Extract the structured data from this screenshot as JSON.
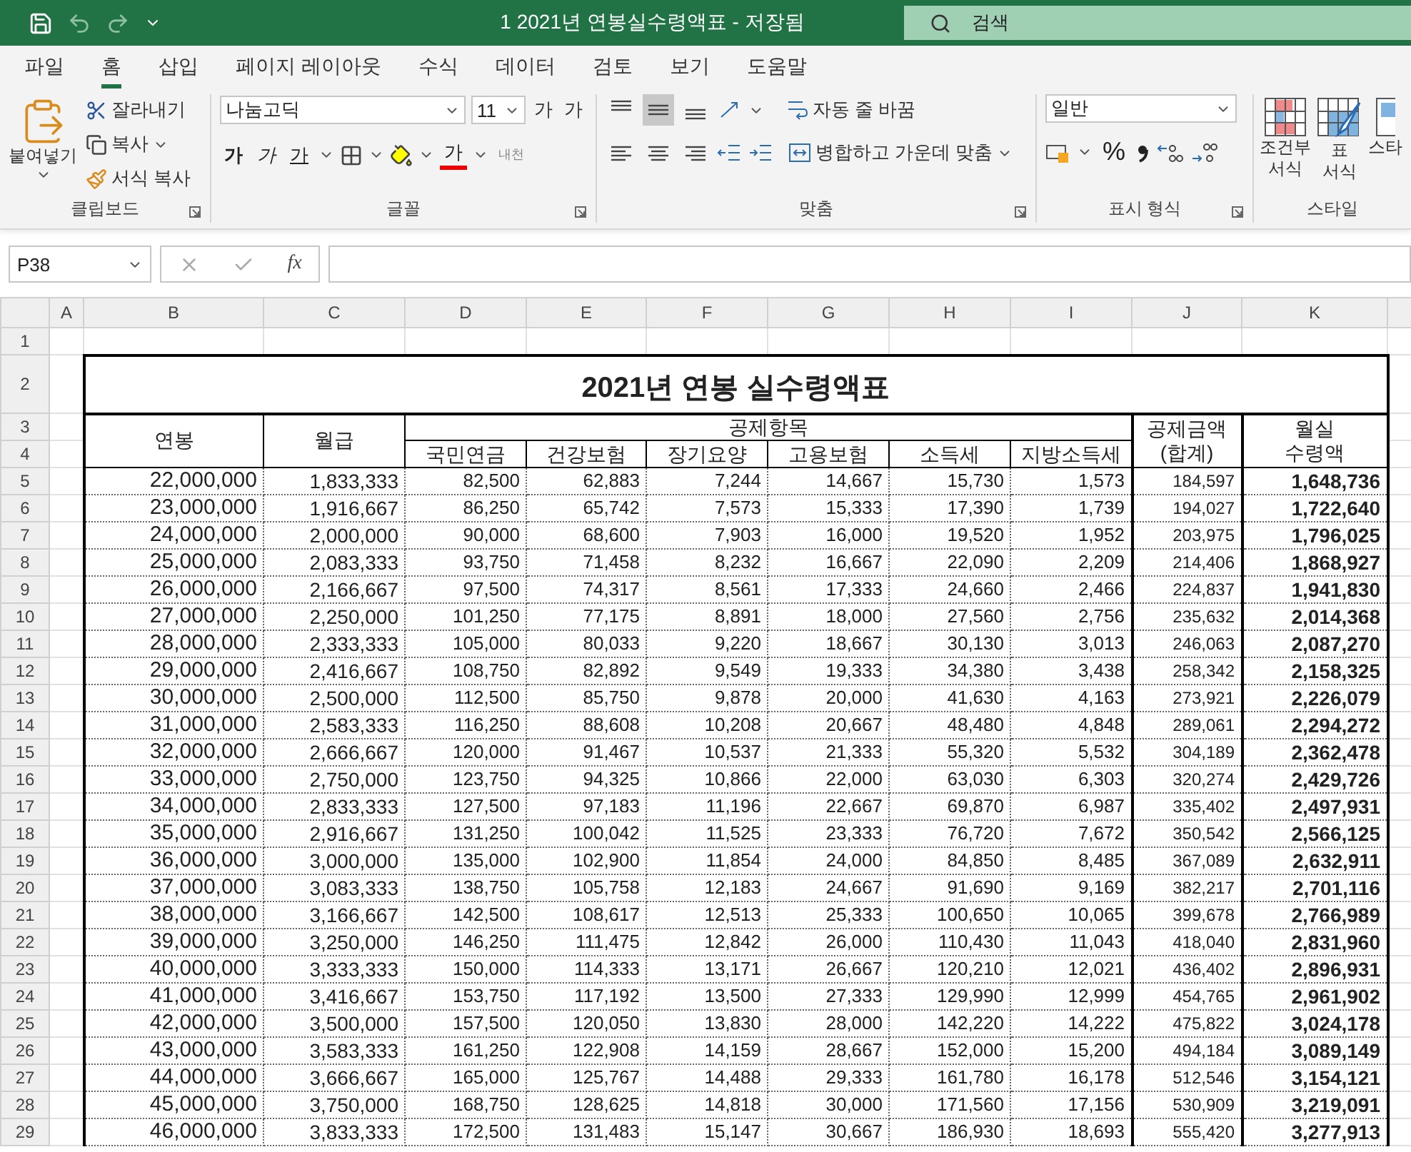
{
  "title_bar": {
    "title": "1 2021년 연봉실수령액표  -  저장됨",
    "search_placeholder": "검색"
  },
  "menu_tabs": [
    {
      "label": "파일",
      "selected": false
    },
    {
      "label": "홈",
      "selected": true
    },
    {
      "label": "삽입",
      "selected": false
    },
    {
      "label": "페이지 레이아웃",
      "selected": false
    },
    {
      "label": "수식",
      "selected": false
    },
    {
      "label": "데이터",
      "selected": false
    },
    {
      "label": "검토",
      "selected": false
    },
    {
      "label": "보기",
      "selected": false
    },
    {
      "label": "도움말",
      "selected": false
    }
  ],
  "ribbon": {
    "clipboard": {
      "label": "클립보드",
      "paste": "붙여넣기",
      "cut": "잘라내기",
      "copy": "복사",
      "format_painter": "서식 복사"
    },
    "font": {
      "label": "글꼴",
      "font_name": "나눔고딕",
      "font_size": "11",
      "grow": "가",
      "shrink": "가",
      "bold": "가",
      "italic": "가",
      "underline": "가",
      "font_color": "가",
      "phonetic": "내천"
    },
    "alignment": {
      "label": "맞춤",
      "vertical": [
        {
          "kind": "top",
          "selected": false
        },
        {
          "kind": "middle",
          "selected": true
        },
        {
          "kind": "bottom",
          "selected": false
        }
      ],
      "horizontal": [
        {
          "kind": "left",
          "selected": false
        },
        {
          "kind": "center",
          "selected": false
        },
        {
          "kind": "right",
          "selected": false
        }
      ],
      "wrap_text": "자동 줄 바꿈",
      "merge_center": "병합하고 가운데 맞춤"
    },
    "number": {
      "label": "표시 형식",
      "format": "일반",
      "percent": "%"
    },
    "styles": {
      "label": "스타일",
      "items": [
        {
          "kind": "conditional",
          "lines": [
            "조건부",
            "서식"
          ]
        },
        {
          "kind": "table",
          "lines": [
            "표",
            "서식"
          ]
        },
        {
          "kind": "cell",
          "lines": [
            "스타"
          ]
        }
      ]
    }
  },
  "formula_bar": {
    "name_box": "P38",
    "function_label": "fx"
  },
  "column_letters": [
    "A",
    "B",
    "C",
    "D",
    "E",
    "F",
    "G",
    "H",
    "I",
    "J",
    "K"
  ],
  "row_numbers": [
    "1",
    "2",
    "3",
    "4",
    "5",
    "6",
    "7",
    "8",
    "9",
    "10",
    "11",
    "12",
    "13",
    "14",
    "15",
    "16",
    "17",
    "18",
    "19",
    "20",
    "21",
    "22",
    "23",
    "24",
    "25",
    "26",
    "27",
    "28",
    "29"
  ],
  "sheet": {
    "title": "2021년 연봉 실수령액표",
    "headers": {
      "annual": "연봉",
      "monthly": "월급",
      "deductions": "공제항목",
      "deduction_items": [
        "국민연금",
        "건강보험",
        "장기요양",
        "고용보험",
        "소득세",
        "지방소득세"
      ],
      "total": "공제금액\n(합계)",
      "net": "월실\n수령액"
    },
    "rows": [
      [
        "22,000,000",
        "1,833,333",
        "82,500",
        "62,883",
        "7,244",
        "14,667",
        "15,730",
        "1,573",
        "184,597",
        "1,648,736"
      ],
      [
        "23,000,000",
        "1,916,667",
        "86,250",
        "65,742",
        "7,573",
        "15,333",
        "17,390",
        "1,739",
        "194,027",
        "1,722,640"
      ],
      [
        "24,000,000",
        "2,000,000",
        "90,000",
        "68,600",
        "7,903",
        "16,000",
        "19,520",
        "1,952",
        "203,975",
        "1,796,025"
      ],
      [
        "25,000,000",
        "2,083,333",
        "93,750",
        "71,458",
        "8,232",
        "16,667",
        "22,090",
        "2,209",
        "214,406",
        "1,868,927"
      ],
      [
        "26,000,000",
        "2,166,667",
        "97,500",
        "74,317",
        "8,561",
        "17,333",
        "24,660",
        "2,466",
        "224,837",
        "1,941,830"
      ],
      [
        "27,000,000",
        "2,250,000",
        "101,250",
        "77,175",
        "8,891",
        "18,000",
        "27,560",
        "2,756",
        "235,632",
        "2,014,368"
      ],
      [
        "28,000,000",
        "2,333,333",
        "105,000",
        "80,033",
        "9,220",
        "18,667",
        "30,130",
        "3,013",
        "246,063",
        "2,087,270"
      ],
      [
        "29,000,000",
        "2,416,667",
        "108,750",
        "82,892",
        "9,549",
        "19,333",
        "34,380",
        "3,438",
        "258,342",
        "2,158,325"
      ],
      [
        "30,000,000",
        "2,500,000",
        "112,500",
        "85,750",
        "9,878",
        "20,000",
        "41,630",
        "4,163",
        "273,921",
        "2,226,079"
      ],
      [
        "31,000,000",
        "2,583,333",
        "116,250",
        "88,608",
        "10,208",
        "20,667",
        "48,480",
        "4,848",
        "289,061",
        "2,294,272"
      ],
      [
        "32,000,000",
        "2,666,667",
        "120,000",
        "91,467",
        "10,537",
        "21,333",
        "55,320",
        "5,532",
        "304,189",
        "2,362,478"
      ],
      [
        "33,000,000",
        "2,750,000",
        "123,750",
        "94,325",
        "10,866",
        "22,000",
        "63,030",
        "6,303",
        "320,274",
        "2,429,726"
      ],
      [
        "34,000,000",
        "2,833,333",
        "127,500",
        "97,183",
        "11,196",
        "22,667",
        "69,870",
        "6,987",
        "335,402",
        "2,497,931"
      ],
      [
        "35,000,000",
        "2,916,667",
        "131,250",
        "100,042",
        "11,525",
        "23,333",
        "76,720",
        "7,672",
        "350,542",
        "2,566,125"
      ],
      [
        "36,000,000",
        "3,000,000",
        "135,000",
        "102,900",
        "11,854",
        "24,000",
        "84,850",
        "8,485",
        "367,089",
        "2,632,911"
      ],
      [
        "37,000,000",
        "3,083,333",
        "138,750",
        "105,758",
        "12,183",
        "24,667",
        "91,690",
        "9,169",
        "382,217",
        "2,701,116"
      ],
      [
        "38,000,000",
        "3,166,667",
        "142,500",
        "108,617",
        "12,513",
        "25,333",
        "100,650",
        "10,065",
        "399,678",
        "2,766,989"
      ],
      [
        "39,000,000",
        "3,250,000",
        "146,250",
        "111,475",
        "12,842",
        "26,000",
        "110,430",
        "11,043",
        "418,040",
        "2,831,960"
      ],
      [
        "40,000,000",
        "3,333,333",
        "150,000",
        "114,333",
        "13,171",
        "26,667",
        "120,210",
        "12,021",
        "436,402",
        "2,896,931"
      ],
      [
        "41,000,000",
        "3,416,667",
        "153,750",
        "117,192",
        "13,500",
        "27,333",
        "129,990",
        "12,999",
        "454,765",
        "2,961,902"
      ],
      [
        "42,000,000",
        "3,500,000",
        "157,500",
        "120,050",
        "13,830",
        "28,000",
        "142,220",
        "14,222",
        "475,822",
        "3,024,178"
      ],
      [
        "43,000,000",
        "3,583,333",
        "161,250",
        "122,908",
        "14,159",
        "28,667",
        "152,000",
        "15,200",
        "494,184",
        "3,089,149"
      ],
      [
        "44,000,000",
        "3,666,667",
        "165,000",
        "125,767",
        "14,488",
        "29,333",
        "161,780",
        "16,178",
        "512,546",
        "3,154,121"
      ],
      [
        "45,000,000",
        "3,750,000",
        "168,750",
        "128,625",
        "14,818",
        "30,000",
        "171,560",
        "17,156",
        "530,909",
        "3,219,091"
      ],
      [
        "46,000,000",
        "3,833,333",
        "172,500",
        "131,483",
        "15,147",
        "30,667",
        "186,930",
        "18,693",
        "555,420",
        "3,277,913"
      ]
    ]
  }
}
